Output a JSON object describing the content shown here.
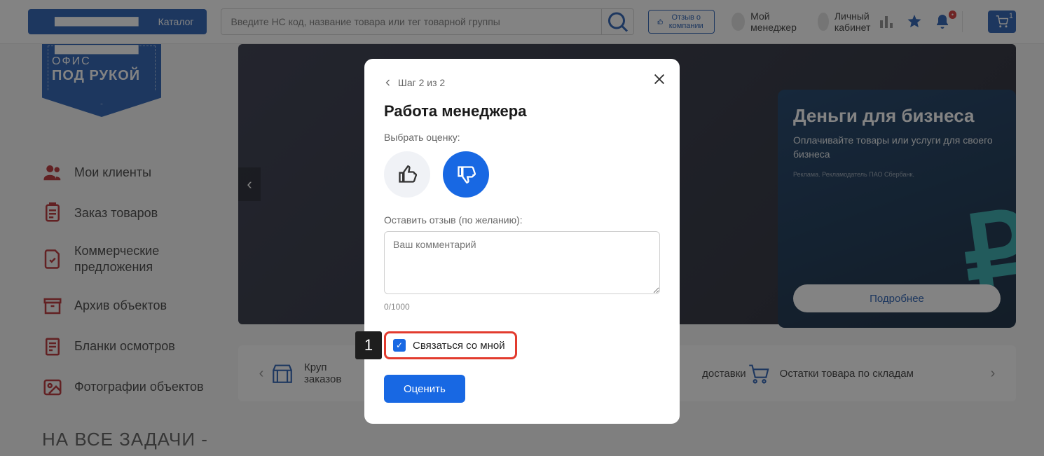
{
  "header": {
    "catalog": "Каталог",
    "search_placeholder": "Введите НС код, название товара или тег товарной группы",
    "review_company": "Отзыв о компании",
    "my_manager": "Мой менеджер",
    "personal_cabinet": "Личный кабинет",
    "cart_count": "1"
  },
  "sidebar": {
    "logo_line1": "ОФИС",
    "logo_line2": "ПОД РУКОЙ",
    "menu": [
      "Мои клиенты",
      "Заказ товаров",
      "Коммерческие предложения",
      "Архив объектов",
      "Бланки осмотров",
      "Фотографии объектов"
    ],
    "bottom_title": "НА ВСЕ ЗАДАЧИ -"
  },
  "promo": {
    "title": "Деньги для бизнеса",
    "subtitle": "Оплачивайте товары или услуги для своего бизнеса",
    "button": "Подробнее"
  },
  "info_strip": {
    "item1_line1": "Круп",
    "item1_line2": "заказов",
    "item2": "доставки",
    "item3": "Остатки товара по складам"
  },
  "modal": {
    "step": "Шаг 2 из 2",
    "title": "Работа менеджера",
    "rate_label": "Выбрать оценку:",
    "review_label": "Оставить отзыв (по желанию):",
    "textarea_placeholder": "Ваш комментарий",
    "counter": "0/1000",
    "contact_me": "Связаться со мной",
    "submit": "Оценить",
    "annotation": "1"
  }
}
